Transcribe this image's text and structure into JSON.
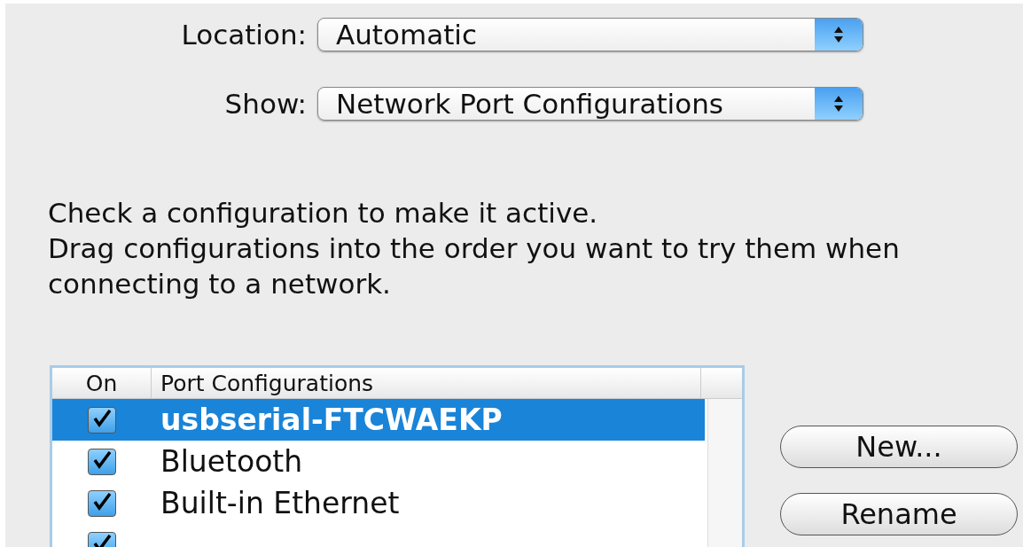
{
  "popups": [
    {
      "label": "Location:",
      "value": "Automatic"
    },
    {
      "label": "Show:",
      "value": "Network Port Configurations"
    }
  ],
  "instructions": [
    "Check a configuration to make it active.",
    "Drag configurations into the order you want to try them when connecting to a network."
  ],
  "table": {
    "columns": [
      "On",
      "Port Configurations"
    ],
    "rows": [
      {
        "name": "usbserial-FTCWAEKP",
        "checked": true,
        "selected": true
      },
      {
        "name": "Bluetooth",
        "checked": true,
        "selected": false
      },
      {
        "name": "Built-in Ethernet",
        "checked": true,
        "selected": false
      },
      {
        "checked": true,
        "selected": false
      }
    ]
  },
  "buttons": [
    "New...",
    "Rename"
  ]
}
